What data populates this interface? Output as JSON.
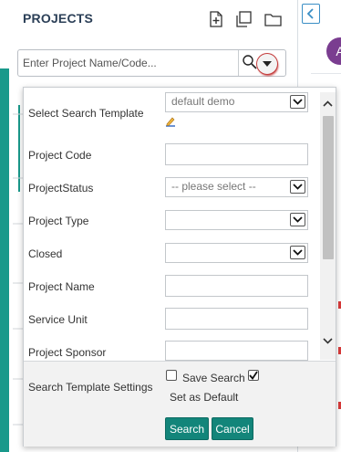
{
  "header": {
    "title": "PROJECTS",
    "icons": [
      "new-project-icon",
      "duplicate-icon",
      "folder-icon"
    ]
  },
  "sidebar_toggle": {
    "icon": "chevron-left-icon"
  },
  "avatar": {
    "initial": "A",
    "color": "#7a3d90"
  },
  "search": {
    "placeholder": "Enter Project Name/Code...",
    "value": "",
    "icon": "search-icon",
    "dropdown_icon": "caret-down-icon"
  },
  "panel": {
    "fields": [
      {
        "label": "Select Search Template",
        "type": "select",
        "value": "default demo"
      },
      {
        "label": "Project Code",
        "type": "text",
        "value": ""
      },
      {
        "label": "ProjectStatus",
        "type": "select",
        "value": "-- please select --"
      },
      {
        "label": "Project Type",
        "type": "select",
        "value": ""
      },
      {
        "label": "Closed",
        "type": "select",
        "value": ""
      },
      {
        "label": "Project Name",
        "type": "text",
        "value": ""
      },
      {
        "label": "Service Unit",
        "type": "text",
        "value": ""
      },
      {
        "label": "Project Sponsor",
        "type": "text",
        "value": ""
      }
    ],
    "edit_icon": "pencil-icon"
  },
  "footer": {
    "settings_label": "Search Template Settings",
    "save_search_label": "Save Search",
    "save_search_checked": false,
    "set_default_label": "Set as Default",
    "set_default_checked": true,
    "search_button": "Search",
    "cancel_button": "Cancel"
  },
  "colors": {
    "accent": "#13857a",
    "title": "#2b3f57",
    "link": "#3a8ec5",
    "highlight_ring": "#c43c3c"
  }
}
